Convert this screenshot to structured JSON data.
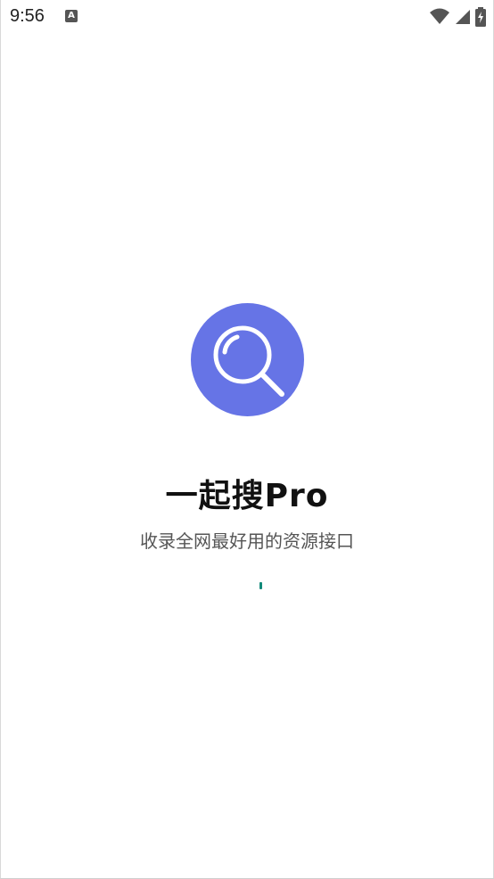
{
  "status_bar": {
    "time": "9:56",
    "notification_icon": "A",
    "icons": [
      "wifi-icon",
      "signal-icon",
      "battery-charging-icon"
    ]
  },
  "app": {
    "title": "一起搜Pro",
    "subtitle": "收录全网最好用的资源接口",
    "logo_icon": "magnifier-icon"
  },
  "colors": {
    "logo_bg": "#6674e6",
    "loading": "#138a7a",
    "title": "#111111",
    "subtitle": "#555555"
  }
}
